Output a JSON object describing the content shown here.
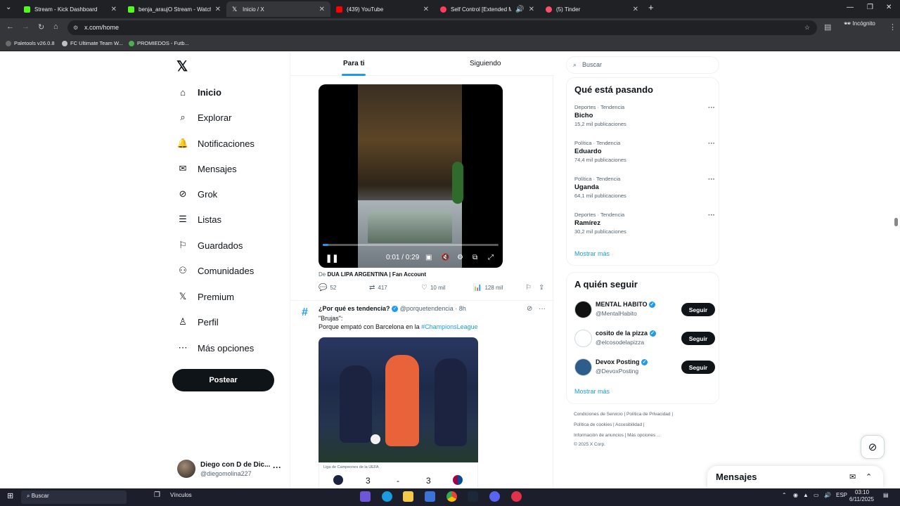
{
  "browser": {
    "tabs": [
      {
        "label": "Stream - Kick Dashboard",
        "color": "#53fc18"
      },
      {
        "label": "benja_araujO Stream - Watch L",
        "color": "#53fc18"
      },
      {
        "label": "Inicio / X",
        "color": "#ffffff"
      },
      {
        "label": "(439) YouTube",
        "color": "#ff0000"
      },
      {
        "label": "Self Control [Extended Mix]",
        "color": "#ff3d5a"
      },
      {
        "label": "(5) Tinder",
        "color": "#fd5068"
      }
    ],
    "url": "x.com/home",
    "incognito_label": "Incógnito",
    "bookmarks": [
      "Paletools v26.0.8",
      "FC Ultimate Team W...",
      "PROMIEDOS - Futb..."
    ]
  },
  "sidebar": {
    "items": [
      {
        "label": "Inicio",
        "icon": "home-icon",
        "glyph": "⌂"
      },
      {
        "label": "Explorar",
        "icon": "search-icon",
        "glyph": "⌕"
      },
      {
        "label": "Notificaciones",
        "icon": "bell-icon",
        "glyph": "🔔"
      },
      {
        "label": "Mensajes",
        "icon": "mail-icon",
        "glyph": "✉"
      },
      {
        "label": "Grok",
        "icon": "grok-icon",
        "glyph": "⊘"
      },
      {
        "label": "Listas",
        "icon": "list-icon",
        "glyph": "☰"
      },
      {
        "label": "Guardados",
        "icon": "bookmark-icon",
        "glyph": "⚐"
      },
      {
        "label": "Comunidades",
        "icon": "communities-icon",
        "glyph": "⚇"
      },
      {
        "label": "Premium",
        "icon": "x-icon",
        "glyph": "𝕏"
      },
      {
        "label": "Perfil",
        "icon": "person-icon",
        "glyph": "♙"
      },
      {
        "label": "Más opciones",
        "icon": "more-icon",
        "glyph": "⋯"
      }
    ],
    "post_label": "Postear",
    "profile": {
      "name": "Diego con D de Dic...",
      "handle": "@diegomolina227"
    }
  },
  "feed": {
    "tabs": [
      "Para ti",
      "Siguiendo"
    ],
    "video": {
      "time": "0:01 / 0:29",
      "progress": 0.03
    },
    "from_prefix": "De",
    "from_account": "DUA LIPA ARGENTINA | Fan Account",
    "stats": {
      "replies": "52",
      "reposts": "417",
      "likes": "10 mil",
      "views": "128 mil"
    },
    "tweet2": {
      "author": "¿Por qué es tendencia?",
      "handle_time": "@porquetendencia · 8h",
      "line1": "\"Brujas\":",
      "line2": "Porque empató con Barcelona en la",
      "hashtag": "#ChampionsLeague",
      "league": "Liga de Campeones de la UEFA",
      "score_home": "3",
      "score_dash": "-",
      "score_away": "3"
    }
  },
  "right": {
    "search_placeholder": "Buscar",
    "trending_title": "Qué está pasando",
    "trends": [
      {
        "meta": "Deportes · Tendencia",
        "name": "Bicho",
        "count": "15,2 mil publicaciones"
      },
      {
        "meta": "Política · Tendencia",
        "name": "Eduardo",
        "count": "74,4 mil publicaciones"
      },
      {
        "meta": "Política · Tendencia",
        "name": "Uganda",
        "count": "64,1 mil publicaciones"
      },
      {
        "meta": "Deportes · Tendencia",
        "name": "Ramírez",
        "count": "30,2 mil publicaciones"
      }
    ],
    "show_more": "Mostrar más",
    "who_title": "A quién seguir",
    "follows": [
      {
        "name": "MENTAL HABITO",
        "handle": "@MentalHabito",
        "button": "Seguir"
      },
      {
        "name": "cosito de la pizza",
        "handle": "@elcosodelapizza",
        "button": "Seguir"
      },
      {
        "name": "Devox Posting",
        "handle": "@DevoxPosting",
        "button": "Seguir"
      }
    ],
    "footer": {
      "line1": "Condiciones de Servicio  |  Política de Privacidad  |",
      "line2": "Política de cookies  |  Accesibilidad  |",
      "line3": "Información de anuncios  |  Más opciones ...",
      "line4": "© 2025 X Corp."
    }
  },
  "messages_dock": {
    "title": "Mensajes"
  },
  "taskbar": {
    "search": "Buscar",
    "vinculos": "Vínculos",
    "lang": "ESP",
    "time": "03:10",
    "date": "6/11/2025"
  }
}
